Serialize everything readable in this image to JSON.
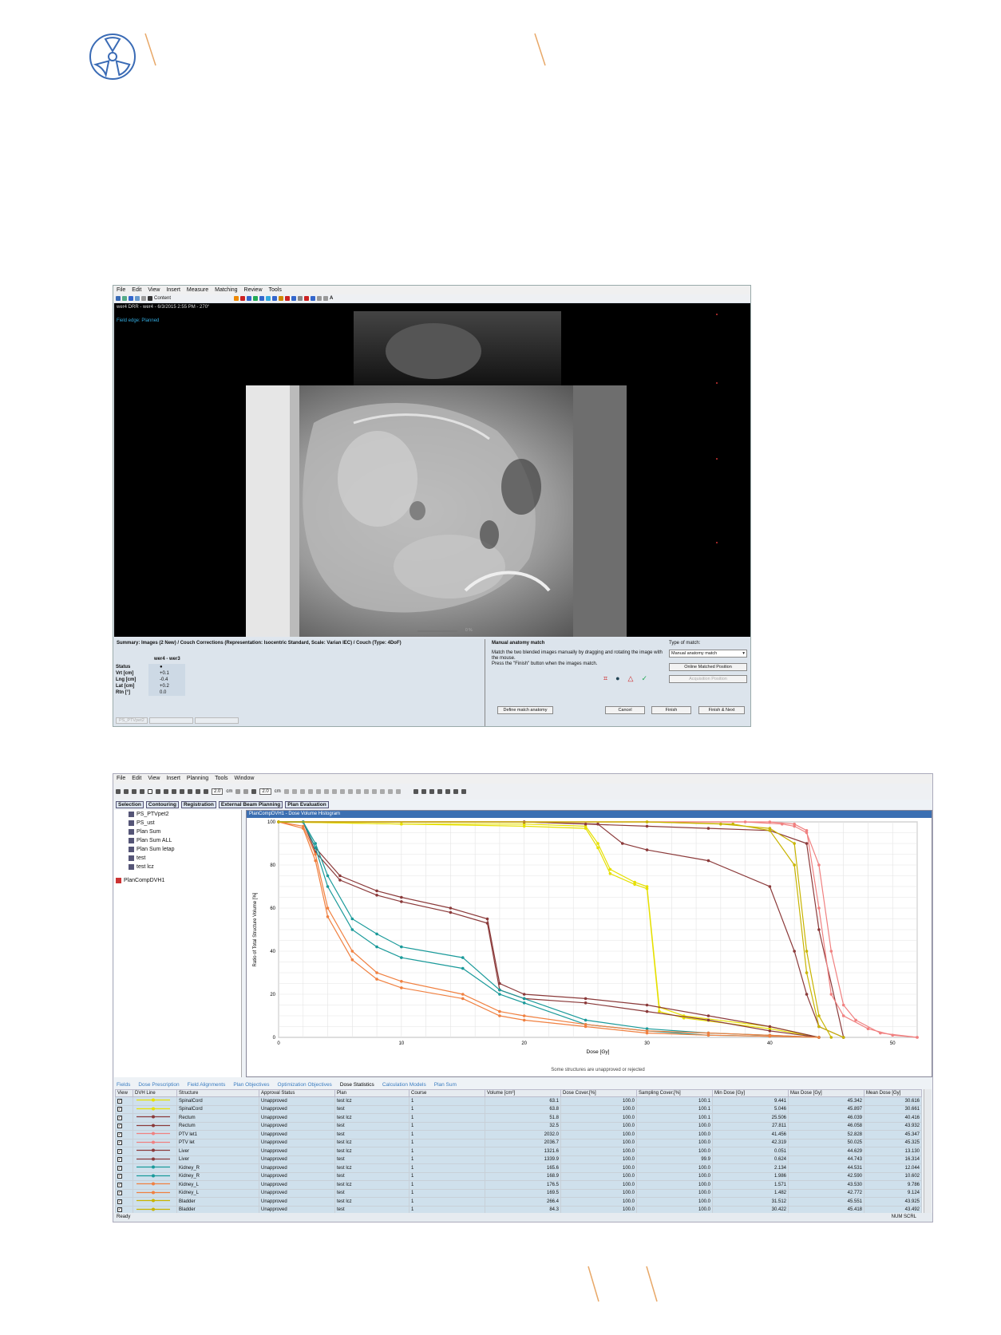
{
  "colors": {
    "accent": "#e8a868",
    "logo": "#3a6bb5",
    "dvh_title_bar": "#3b6fb2"
  },
  "logo": {
    "icon": "radiation-icon"
  },
  "window1": {
    "menu": [
      "File",
      "Edit",
      "View",
      "Insert",
      "Measure",
      "Matching",
      "Review",
      "Tools"
    ],
    "content_label": "Content",
    "image_title": "wer4 DRR - wer4 - 6/3/2015 2:55 PM - 270°",
    "field_edge": "Field edge: Planned",
    "slider_value": "0 %",
    "summary_title": "Summary: Images (2 New) / Couch Corrections (Representation: Isocentric Standard, Scale: Varian IEC) / Couch (Type: 4DoF)",
    "column_header": "wer4 - wer3",
    "rows": [
      {
        "label": "Status",
        "value": "●"
      },
      {
        "label": "Vrt [cm]",
        "value": "+0.1"
      },
      {
        "label": "Lng [cm]",
        "value": "-0.4"
      },
      {
        "label": "Lat [cm]",
        "value": "+0.2"
      },
      {
        "label": "Rtn [°]",
        "value": "0.0"
      }
    ],
    "bottom_tabs": [
      "PS_PTVpet2",
      "",
      "",
      ""
    ],
    "match_title": "Manual anatomy match",
    "match_desc": "Match the two blended images manually by dragging and rotating the image with the mouse.",
    "match_desc2": "Press the \"Finish\" button when the images match.",
    "type_label": "Type of match:",
    "type_value": "Manual anatomy match",
    "online_btn": "Online Matched Position",
    "acq_btn": "Acquisition Position",
    "define_btn": "Define match anatomy",
    "cancel_btn": "Cancel",
    "finish_btn": "Finish",
    "finish_next_btn": "Finish & Next"
  },
  "window2": {
    "menu": [
      "File",
      "Edit",
      "View",
      "Insert",
      "Planning",
      "Tools",
      "Window"
    ],
    "tb_value1": "2.0",
    "tb_unit1": "cm",
    "tb_value2": "2.0",
    "tb_unit2": "cm",
    "workspace_tabs": [
      "Selection",
      "Contouring",
      "Registration",
      "External Beam Planning",
      "Plan Evaluation"
    ],
    "tree": [
      "PS_PTVpet2",
      "PS_ust",
      "Plan Sum",
      "Plan Sum ALL",
      "Plan Sum letap",
      "test",
      "test lcz",
      "PlanCompDVH1"
    ],
    "dvh_title": "PlanCompDVH1 - Dose Volume Histogram",
    "y_label": "Ratio of Total Structure Volume [%]",
    "x_label": "Dose [Gy]",
    "note": "Some structures are unapproved or rejected",
    "panel_tabs": [
      "Fields",
      "Dose Prescription",
      "Field Alignments",
      "Plan Objectives",
      "Optimization Objectives",
      "Dose Statistics",
      "Calculation Models",
      "Plan Sum"
    ],
    "table_headers": [
      "View",
      "DVH Line",
      "Structure",
      "Approval Status",
      "Plan",
      "Course",
      "Volume [cm³]",
      "Dose Cover.[%]",
      "Sampling Cover.[%]",
      "Min Dose [Gy]",
      "Max Dose [Gy]",
      "Mean Dose [Gy]"
    ],
    "table_rows": [
      [
        "SpinalCord",
        "Unapproved",
        "test lcz",
        "1",
        "63.1",
        "100.0",
        "100.1",
        "9.441",
        "45.342",
        "30.616"
      ],
      [
        "SpinalCord",
        "Unapproved",
        "test",
        "1",
        "63.8",
        "100.0",
        "100.1",
        "5.046",
        "45.897",
        "30.661"
      ],
      [
        "Rectum",
        "Unapproved",
        "test lcz",
        "1",
        "51.8",
        "100.0",
        "100.1",
        "25.506",
        "46.039",
        "40.416"
      ],
      [
        "Rectum",
        "Unapproved",
        "test",
        "1",
        "32.5",
        "100.0",
        "100.0",
        "27.811",
        "46.058",
        "43.932"
      ],
      [
        "PTV let1",
        "Unapproved",
        "test",
        "1",
        "2032.0",
        "100.0",
        "100.0",
        "41.456",
        "52.828",
        "45.347"
      ],
      [
        "PTV let",
        "Unapproved",
        "test lcz",
        "1",
        "2036.7",
        "100.0",
        "100.0",
        "42.319",
        "50.025",
        "45.325"
      ],
      [
        "Liver",
        "Unapproved",
        "test lcz",
        "1",
        "1321.6",
        "100.0",
        "100.0",
        "0.051",
        "44.629",
        "13.130"
      ],
      [
        "Liver",
        "Unapproved",
        "test",
        "1",
        "1339.9",
        "100.0",
        "99.9",
        "0.624",
        "44.743",
        "16.314"
      ],
      [
        "Kidney_R",
        "Unapproved",
        "test lcz",
        "1",
        "165.6",
        "100.0",
        "100.0",
        "2.134",
        "44.531",
        "12.044"
      ],
      [
        "Kidney_R",
        "Unapproved",
        "test",
        "1",
        "168.9",
        "100.0",
        "100.0",
        "1.986",
        "42.590",
        "10.602"
      ],
      [
        "Kidney_L",
        "Unapproved",
        "test lcz",
        "1",
        "176.5",
        "100.0",
        "100.0",
        "1.571",
        "43.530",
        "9.786"
      ],
      [
        "Kidney_L",
        "Unapproved",
        "test",
        "1",
        "169.5",
        "100.0",
        "100.0",
        "1.482",
        "42.772",
        "9.124"
      ],
      [
        "Bladder",
        "Unapproved",
        "test lcz",
        "1",
        "266.4",
        "100.0",
        "100.0",
        "31.512",
        "45.551",
        "43.925"
      ],
      [
        "Bladder",
        "Unapproved",
        "test",
        "1",
        "84.3",
        "100.0",
        "100.0",
        "30.422",
        "45.418",
        "43.492"
      ]
    ],
    "row_colors": [
      "#e6e000",
      "#e6e000",
      "#8b3a3a",
      "#8b3a3a",
      "#f08080",
      "#f08080",
      "#8b3a3a",
      "#8b3a3a",
      "#1a9a9a",
      "#1a9a9a",
      "#f08040",
      "#f08040",
      "#c8b400",
      "#c8b400"
    ],
    "status": "Ready",
    "status_right": "NUM SCRL"
  },
  "chart_data": {
    "type": "line",
    "title": "PlanCompDVH1 - Dose Volume Histogram",
    "xlabel": "Dose [Gy]",
    "ylabel": "Ratio of Total Structure Volume [%]",
    "xlim": [
      0,
      52
    ],
    "ylim": [
      0,
      100
    ],
    "xticks": [
      0,
      10,
      20,
      30,
      40,
      50
    ],
    "yticks": [
      0,
      20,
      40,
      60,
      80,
      100
    ],
    "grid": true,
    "series": [
      {
        "color": "#e6e000",
        "x": [
          0,
          10,
          20,
          25,
          26,
          27,
          29,
          30,
          31,
          33,
          40,
          44
        ],
        "y": [
          100,
          99,
          99,
          98,
          90,
          78,
          72,
          70,
          14,
          10,
          5,
          0
        ]
      },
      {
        "color": "#e6e000",
        "x": [
          0,
          10,
          20,
          25,
          26,
          27,
          29,
          30,
          31,
          33,
          40,
          44
        ],
        "y": [
          100,
          99,
          98,
          97,
          88,
          76,
          71,
          69,
          12,
          9,
          4,
          0
        ]
      },
      {
        "color": "#8b3a3a",
        "x": [
          0,
          20,
          25,
          30,
          35,
          40,
          43,
          44,
          46
        ],
        "y": [
          100,
          100,
          99,
          98,
          97,
          96,
          90,
          50,
          0
        ]
      },
      {
        "color": "#8b3a3a",
        "x": [
          0,
          20,
          26,
          28,
          30,
          35,
          40,
          42,
          43,
          44,
          46
        ],
        "y": [
          100,
          100,
          99,
          90,
          87,
          82,
          70,
          40,
          20,
          5,
          0
        ]
      },
      {
        "color": "#f08080",
        "x": [
          0,
          38,
          41,
          42,
          43,
          44,
          45,
          46,
          47,
          49,
          52
        ],
        "y": [
          100,
          100,
          99,
          98,
          95,
          80,
          40,
          15,
          8,
          2,
          0
        ]
      },
      {
        "color": "#f08080",
        "x": [
          0,
          40,
          42,
          43,
          44,
          45,
          46,
          48,
          50,
          52
        ],
        "y": [
          100,
          100,
          99,
          96,
          60,
          20,
          10,
          4,
          1,
          0
        ]
      },
      {
        "color": "#8b3a3a",
        "x": [
          0,
          2,
          3,
          5,
          8,
          10,
          14,
          17,
          18,
          20,
          25,
          30,
          35,
          40,
          44
        ],
        "y": [
          100,
          100,
          88,
          75,
          68,
          65,
          60,
          55,
          25,
          20,
          18,
          15,
          10,
          5,
          0
        ]
      },
      {
        "color": "#8b3a3a",
        "x": [
          0,
          2,
          3,
          5,
          8,
          10,
          14,
          17,
          18,
          20,
          25,
          30,
          35,
          40,
          44
        ],
        "y": [
          100,
          100,
          86,
          73,
          66,
          63,
          58,
          53,
          22,
          18,
          16,
          12,
          8,
          3,
          0
        ]
      },
      {
        "color": "#1a9a9a",
        "x": [
          0,
          2,
          3,
          4,
          6,
          8,
          10,
          15,
          18,
          20,
          25,
          30,
          35,
          40,
          44
        ],
        "y": [
          100,
          100,
          90,
          75,
          55,
          48,
          42,
          37,
          22,
          18,
          8,
          4,
          2,
          1,
          0
        ]
      },
      {
        "color": "#1a9a9a",
        "x": [
          0,
          2,
          3,
          4,
          6,
          8,
          10,
          15,
          18,
          20,
          25,
          30,
          35,
          40,
          44
        ],
        "y": [
          100,
          100,
          88,
          70,
          50,
          42,
          37,
          32,
          20,
          16,
          6,
          3,
          1,
          0.5,
          0
        ]
      },
      {
        "color": "#f08040",
        "x": [
          0,
          2,
          3,
          4,
          6,
          8,
          10,
          15,
          18,
          20,
          25,
          30,
          35,
          40,
          44
        ],
        "y": [
          100,
          98,
          85,
          60,
          40,
          30,
          26,
          20,
          12,
          10,
          6,
          3,
          2,
          1,
          0
        ]
      },
      {
        "color": "#f08040",
        "x": [
          0,
          2,
          3,
          4,
          6,
          8,
          10,
          15,
          18,
          20,
          25,
          30,
          35,
          40,
          44
        ],
        "y": [
          100,
          97,
          82,
          56,
          36,
          27,
          23,
          18,
          10,
          8,
          5,
          2,
          1,
          0.5,
          0
        ]
      },
      {
        "color": "#c8b400",
        "x": [
          0,
          30,
          36,
          40,
          42,
          43,
          44,
          45
        ],
        "y": [
          100,
          100,
          99,
          97,
          90,
          40,
          10,
          0
        ]
      },
      {
        "color": "#c8b400",
        "x": [
          0,
          30,
          37,
          40,
          42,
          43,
          44,
          46
        ],
        "y": [
          100,
          100,
          99,
          96,
          80,
          30,
          5,
          0
        ]
      }
    ]
  }
}
